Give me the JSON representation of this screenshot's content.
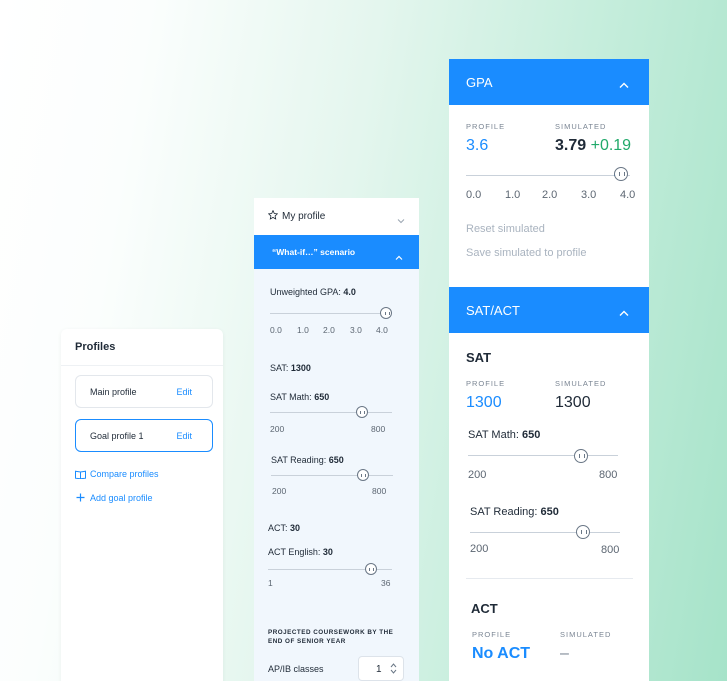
{
  "colors": {
    "accent": "#1a8cff",
    "positive": "#20a96a",
    "muted": "#a9b3bf"
  },
  "profiles": {
    "title": "Profiles",
    "items": [
      {
        "name": "Main profile",
        "edit": "Edit"
      },
      {
        "name": "Goal profile 1",
        "edit": "Edit"
      }
    ],
    "compare_label": "Compare profiles",
    "add_label": "Add goal profile"
  },
  "scenario_panel": {
    "profile_label": "My profile",
    "scenario_label": "“What-if…” scenario",
    "gpa": {
      "label": "Unweighted GPA:",
      "value": "4.0",
      "ticks": [
        "0.0",
        "1.0",
        "2.0",
        "3.0",
        "4.0"
      ],
      "level": 1.0
    },
    "sat": {
      "label": "SAT:",
      "value": "1300"
    },
    "sat_math": {
      "label": "SAT Math:",
      "value": "650",
      "min": "200",
      "max": "800",
      "level": 0.75
    },
    "sat_reading": {
      "label": "SAT Reading:",
      "value": "650",
      "min": "200",
      "max": "800",
      "level": 0.75
    },
    "act": {
      "label": "ACT:",
      "value": "30"
    },
    "act_english": {
      "label": "ACT English:",
      "value": "30",
      "min": "1",
      "max": "36",
      "level": 0.83
    },
    "coursework_heading": "PROJECTED COURSEWORK BY THE END OF SENIOR YEAR",
    "apib": {
      "label": "AP/IB classes",
      "value": "1"
    }
  },
  "detail_panel": {
    "gpa_section": {
      "title": "GPA",
      "profile_caption": "PROFILE",
      "simulated_caption": "SIMULATED",
      "profile_value": "3.6",
      "simulated_value": "3.79",
      "delta": "+0.19",
      "ticks": [
        "0.0",
        "1.0",
        "2.0",
        "3.0",
        "4.0"
      ],
      "level": 0.948,
      "reset_label": "Reset simulated",
      "save_label": "Save simulated to profile"
    },
    "sat_act_section": {
      "title": "SAT/ACT",
      "sat": {
        "heading": "SAT",
        "profile_caption": "PROFILE",
        "simulated_caption": "SIMULATED",
        "profile_value": "1300",
        "simulated_value": "1300",
        "math": {
          "label": "SAT Math:",
          "value": "650",
          "min": "200",
          "max": "800",
          "level": 0.75
        },
        "reading": {
          "label": "SAT Reading:",
          "value": "650",
          "min": "200",
          "max": "800",
          "level": 0.75
        }
      },
      "act": {
        "heading": "ACT",
        "profile_caption": "PROFILE",
        "simulated_caption": "SIMULATED",
        "profile_value": "No ACT",
        "simulated_value": "–"
      }
    }
  }
}
